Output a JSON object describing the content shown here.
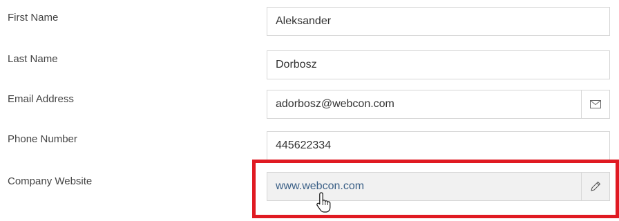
{
  "form": {
    "fields": [
      {
        "label": "First Name",
        "value": "Aleksander"
      },
      {
        "label": "Last Name",
        "value": "Dorbosz"
      },
      {
        "label": "Email Address",
        "value": "adorbosz@webcon.com",
        "icon": "mail-icon"
      },
      {
        "label": "Phone Number",
        "value": "445622334"
      },
      {
        "label": "Company Website",
        "value": "www.webcon.com",
        "icon": "pencil-icon"
      }
    ]
  },
  "colors": {
    "label_text": "#444444",
    "field_border": "#d6d6d6",
    "readonly_bg": "#f1f1f1",
    "link_text": "#3a5f86",
    "highlight": "#e01a22"
  }
}
